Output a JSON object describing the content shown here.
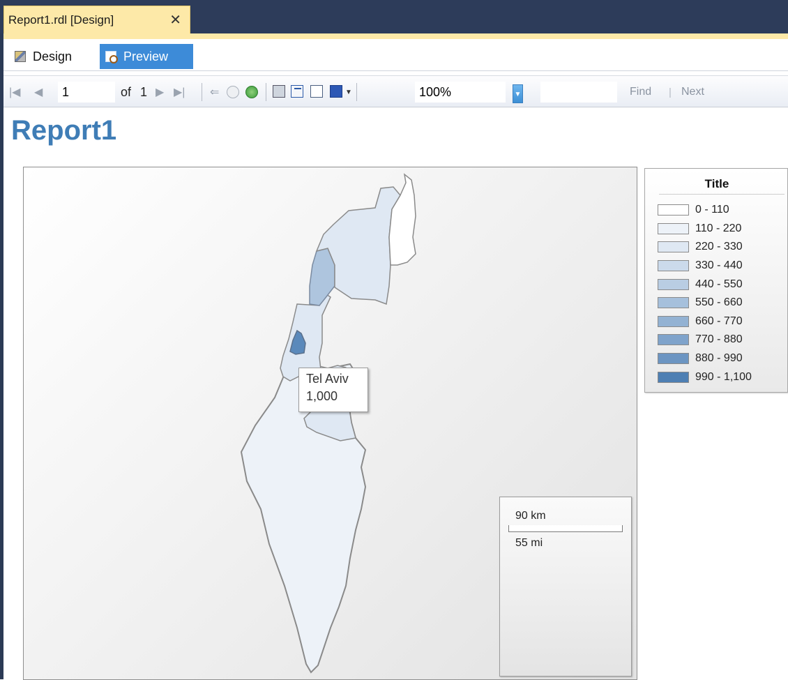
{
  "tab": {
    "title": "Report1.rdl [Design]",
    "close": "✕"
  },
  "views": {
    "design": "Design",
    "preview": "Preview"
  },
  "toolbar": {
    "page_value": "1",
    "of_label": "of",
    "total_pages": "1",
    "zoom_value": "100%",
    "find_label": "Find",
    "find_sep": "|",
    "next_label": "Next"
  },
  "report": {
    "title": "Report1"
  },
  "map": {
    "tooltip": {
      "name": "Tel Aviv",
      "value": "1,000"
    },
    "scale": {
      "km": "90 km",
      "mi": "55 mi"
    },
    "regions": [
      {
        "name": "Golan",
        "fill": "#ffffff"
      },
      {
        "name": "Northern",
        "fill": "#dfe8f3"
      },
      {
        "name": "Haifa",
        "fill": "#aec5de"
      },
      {
        "name": "Central",
        "fill": "#dfe8f3"
      },
      {
        "name": "Tel Aviv",
        "fill": "#5a89bb"
      },
      {
        "name": "Jerusalem",
        "fill": "#dfe8f3"
      },
      {
        "name": "Southern",
        "fill": "#edf2f8"
      }
    ]
  },
  "legend": {
    "title": "Title",
    "items": [
      {
        "label": "0 - 110",
        "color": "#ffffff"
      },
      {
        "label": "110 - 220",
        "color": "#edf2f8"
      },
      {
        "label": "220 - 330",
        "color": "#dfe8f3"
      },
      {
        "label": "330 - 440",
        "color": "#cbdaeb"
      },
      {
        "label": "440 - 550",
        "color": "#b9cde3"
      },
      {
        "label": "550 - 660",
        "color": "#a6c0dc"
      },
      {
        "label": "660 - 770",
        "color": "#93b2d3"
      },
      {
        "label": "770 - 880",
        "color": "#7fa3cb"
      },
      {
        "label": "880 - 990",
        "color": "#6c95c2"
      },
      {
        "label": "990 - 1,100",
        "color": "#4e7fb3"
      }
    ]
  }
}
